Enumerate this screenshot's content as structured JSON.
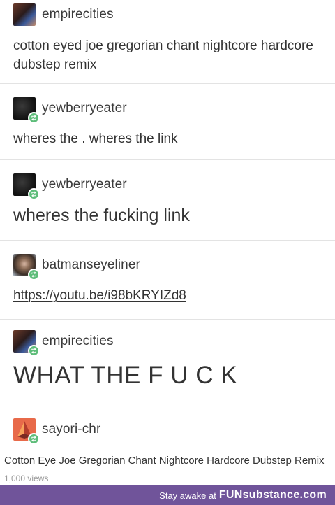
{
  "posts": [
    {
      "username": "empirecities",
      "text": "cotton eyed joe gregorian chant nightcore hardcore dubstep remix",
      "avatar_icon": "profile-photo-icon",
      "reblog": false
    },
    {
      "username": "yewberryeater",
      "text": "wheres the . wheres the link",
      "avatar_icon": "profile-photo-icon",
      "reblog": true
    },
    {
      "username": "yewberryeater",
      "text": "wheres the fucking link",
      "avatar_icon": "profile-photo-icon",
      "reblog": true
    },
    {
      "username": "batmanseyeliner",
      "text": "https://youtu.be/i98bKRYIZd8",
      "avatar_icon": "profile-photo-icon",
      "reblog": true
    },
    {
      "username": "empirecities",
      "text": "WHAT THE F U C K",
      "avatar_icon": "profile-photo-icon",
      "reblog": true
    },
    {
      "username": "sayori-chr",
      "text": "Cotton Eye Joe Gregorian Chant Nightcore Hardcore Dubstep Remix",
      "views": "1,000 views",
      "avatar_icon": "cone-icon",
      "reblog": true
    }
  ],
  "footer": {
    "tagline": "Stay awake at",
    "brand": "FUNsubstance.com"
  },
  "colors": {
    "reblog_badge": "#5ebd7a",
    "footer_bg": "#70549a",
    "divider": "#e3e3e3"
  }
}
